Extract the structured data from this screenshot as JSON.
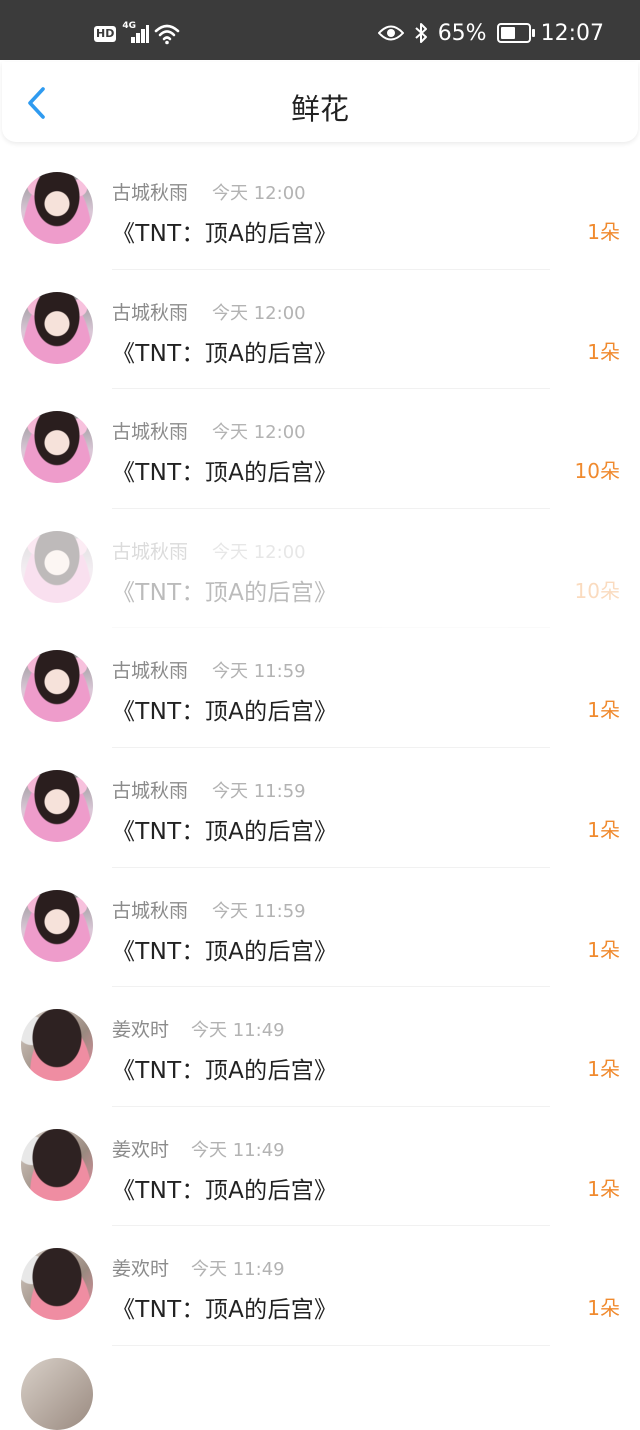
{
  "status_bar": {
    "hd": "HD",
    "network": "4G",
    "battery": "65%",
    "battery_level": 0.65,
    "time": "12:07",
    "icons": [
      "hd-icon",
      "signal-icon",
      "wifi-icon",
      "eye-icon",
      "bluetooth-icon",
      "battery-icon"
    ]
  },
  "header": {
    "title": "鲜花",
    "back_icon": "chevron-left-icon"
  },
  "colors": {
    "accent": "#2f9bf0",
    "count": "#f08a2e",
    "status_bar_bg": "#3b3b3b"
  },
  "list": [
    {
      "user": "古城秋雨",
      "time": "今天 12:00",
      "book": "《TNT：顶A的后宫》",
      "count": "1朵",
      "avatar": "a"
    },
    {
      "user": "古城秋雨",
      "time": "今天 12:00",
      "book": "《TNT：顶A的后宫》",
      "count": "1朵",
      "avatar": "a"
    },
    {
      "user": "古城秋雨",
      "time": "今天 12:00",
      "book": "《TNT：顶A的后宫》",
      "count": "10朵",
      "avatar": "a"
    },
    {
      "user": "古城秋雨",
      "time": "今天 12:00",
      "book": "《TNT：顶A的后宫》",
      "count": "10朵",
      "avatar": "a"
    },
    {
      "user": "古城秋雨",
      "time": "今天 11:59",
      "book": "《TNT：顶A的后宫》",
      "count": "1朵",
      "avatar": "a"
    },
    {
      "user": "古城秋雨",
      "time": "今天 11:59",
      "book": "《TNT：顶A的后宫》",
      "count": "1朵",
      "avatar": "a"
    },
    {
      "user": "古城秋雨",
      "time": "今天 11:59",
      "book": "《TNT：顶A的后宫》",
      "count": "1朵",
      "avatar": "a"
    },
    {
      "user": "姜欢时",
      "time": "今天 11:49",
      "book": "《TNT：顶A的后宫》",
      "count": "1朵",
      "avatar": "b"
    },
    {
      "user": "姜欢时",
      "time": "今天 11:49",
      "book": "《TNT：顶A的后宫》",
      "count": "1朵",
      "avatar": "b"
    },
    {
      "user": "姜欢时",
      "time": "今天 11:49",
      "book": "《TNT：顶A的后宫》",
      "count": "1朵",
      "avatar": "b"
    }
  ]
}
